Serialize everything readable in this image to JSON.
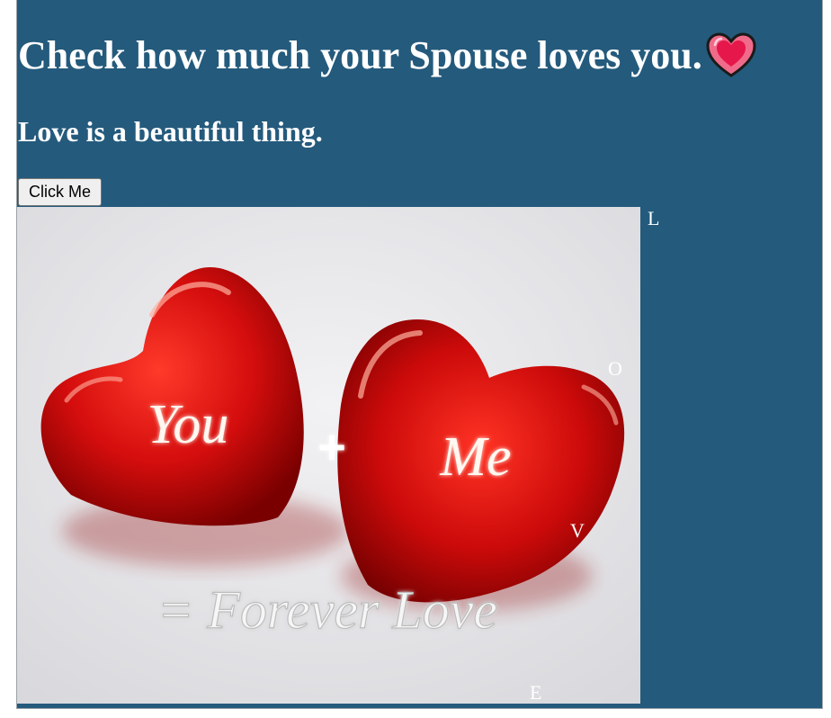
{
  "header": {
    "title": "Check how much your Spouse loves you.",
    "subtitle": "Love is a beautiful thing."
  },
  "button": {
    "label": "Click Me"
  },
  "image": {
    "text_you": "You",
    "text_plus": "+",
    "text_me": "Me",
    "text_forever": "= Forever Love"
  },
  "floating_letters": [
    "L",
    "O",
    "V",
    "E"
  ],
  "colors": {
    "page_bg": "#245a7c",
    "heart_red": "#d40d0d",
    "text": "#ffffff"
  },
  "icons": {
    "title_emoji": "sparkling-heart-icon"
  }
}
